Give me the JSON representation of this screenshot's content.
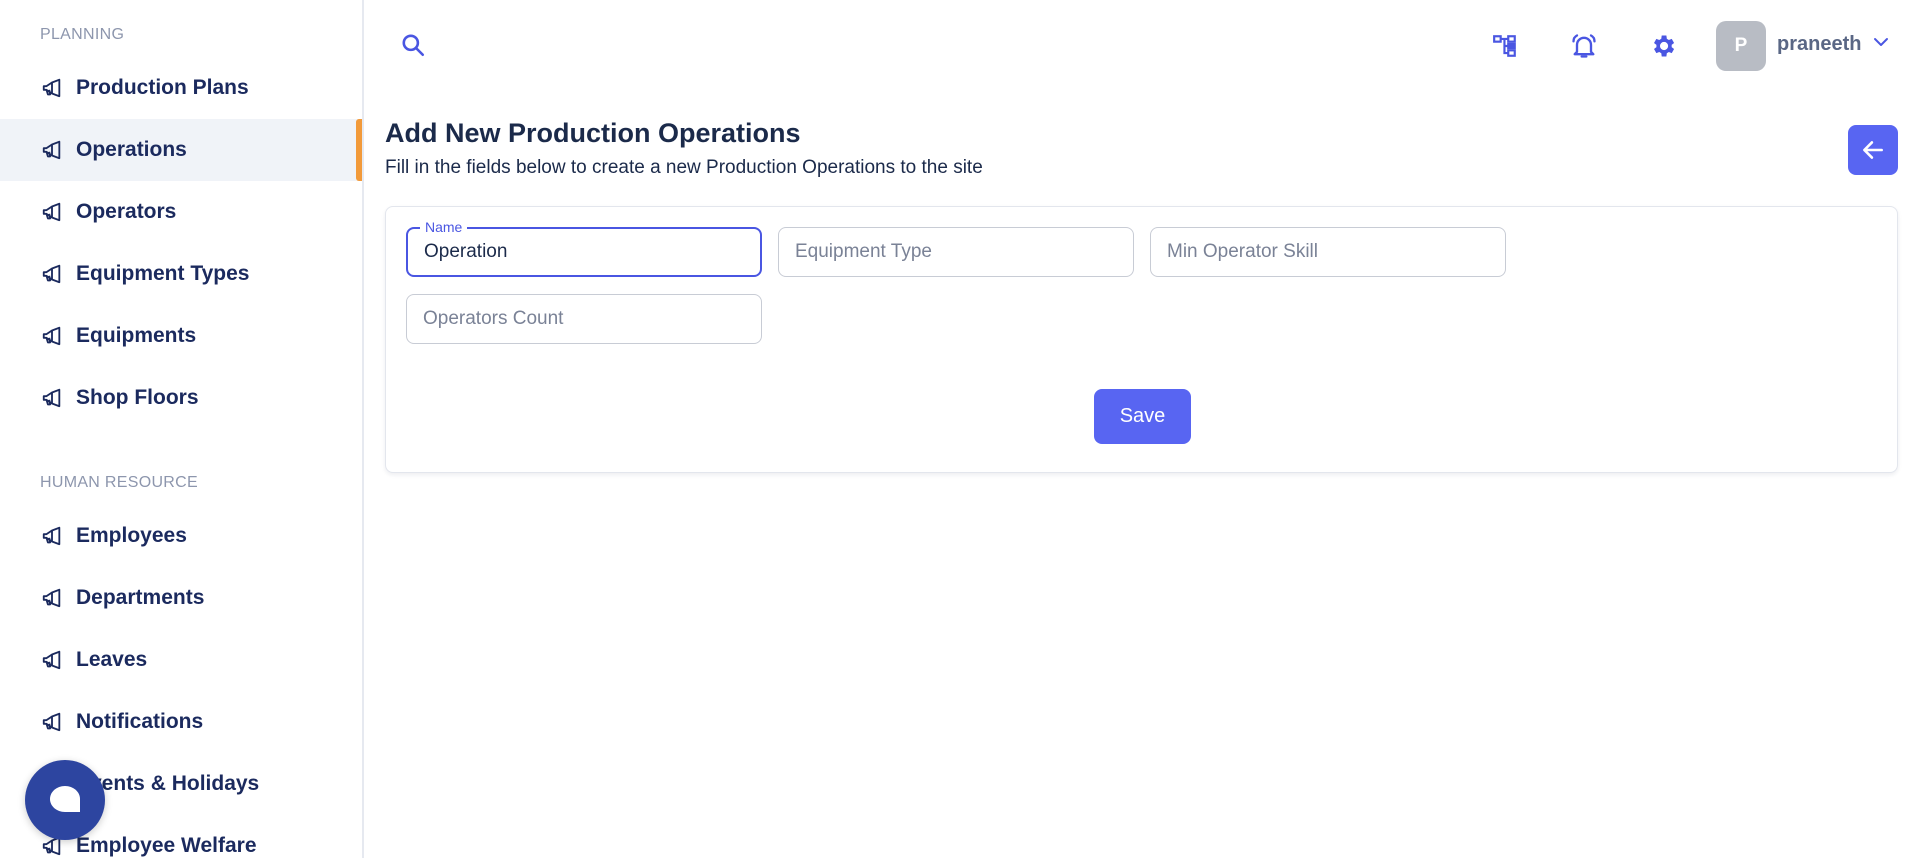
{
  "sidebar": {
    "sections": [
      {
        "title": "PLANNING",
        "items": [
          {
            "label": "Production Plans",
            "icon": "megaphone-icon"
          },
          {
            "label": "Operations",
            "icon": "megaphone-icon",
            "active": true
          },
          {
            "label": "Operators",
            "icon": "megaphone-icon"
          },
          {
            "label": "Equipment Types",
            "icon": "megaphone-icon"
          },
          {
            "label": "Equipments",
            "icon": "megaphone-icon"
          },
          {
            "label": "Shop Floors",
            "icon": "megaphone-icon"
          }
        ]
      },
      {
        "title": "HUMAN RESOURCE",
        "items": [
          {
            "label": "Employees",
            "icon": "megaphone-icon"
          },
          {
            "label": "Departments",
            "icon": "megaphone-icon"
          },
          {
            "label": "Leaves",
            "icon": "megaphone-icon"
          },
          {
            "label": "Notifications",
            "icon": "megaphone-icon"
          },
          {
            "label": "Events & Holidays",
            "icon": "megaphone-icon"
          },
          {
            "label": "Employee Welfare",
            "icon": "megaphone-icon"
          }
        ]
      }
    ]
  },
  "header": {
    "icons": [
      "search-icon",
      "hierarchy-icon",
      "bell-icon",
      "gear-icon",
      "chevron-down-icon"
    ],
    "user": {
      "initial": "P",
      "name": "praneeth"
    }
  },
  "page": {
    "title": "Add New Production Operations",
    "subtitle": "Fill in the fields below to create a new Production Operations to the site"
  },
  "form": {
    "name": {
      "label": "Name",
      "value": "Operation"
    },
    "equipment_type": {
      "placeholder": "Equipment Type",
      "value": ""
    },
    "min_operator_skill": {
      "placeholder": "Min Operator Skill",
      "value": ""
    },
    "operators_count": {
      "placeholder": "Operators Count",
      "value": ""
    },
    "save_label": "Save"
  },
  "colors": {
    "accent": "#5865f2",
    "active_indicator": "#f29a3a",
    "nav_text": "#1b2a5e",
    "chat_button": "#2d45a0"
  }
}
